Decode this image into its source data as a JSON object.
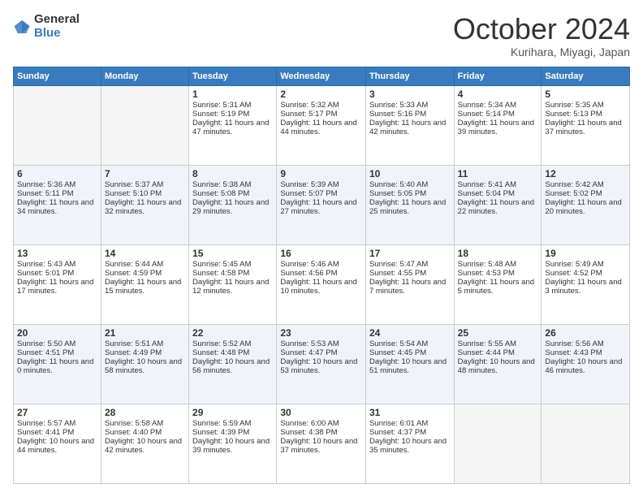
{
  "logo": {
    "general": "General",
    "blue": "Blue"
  },
  "header": {
    "month": "October 2024",
    "location": "Kurihara, Miyagi, Japan"
  },
  "days_of_week": [
    "Sunday",
    "Monday",
    "Tuesday",
    "Wednesday",
    "Thursday",
    "Friday",
    "Saturday"
  ],
  "weeks": [
    [
      {
        "day": "",
        "sunrise": "",
        "sunset": "",
        "daylight": ""
      },
      {
        "day": "",
        "sunrise": "",
        "sunset": "",
        "daylight": ""
      },
      {
        "day": "1",
        "sunrise": "Sunrise: 5:31 AM",
        "sunset": "Sunset: 5:19 PM",
        "daylight": "Daylight: 11 hours and 47 minutes."
      },
      {
        "day": "2",
        "sunrise": "Sunrise: 5:32 AM",
        "sunset": "Sunset: 5:17 PM",
        "daylight": "Daylight: 11 hours and 44 minutes."
      },
      {
        "day": "3",
        "sunrise": "Sunrise: 5:33 AM",
        "sunset": "Sunset: 5:16 PM",
        "daylight": "Daylight: 11 hours and 42 minutes."
      },
      {
        "day": "4",
        "sunrise": "Sunrise: 5:34 AM",
        "sunset": "Sunset: 5:14 PM",
        "daylight": "Daylight: 11 hours and 39 minutes."
      },
      {
        "day": "5",
        "sunrise": "Sunrise: 5:35 AM",
        "sunset": "Sunset: 5:13 PM",
        "daylight": "Daylight: 11 hours and 37 minutes."
      }
    ],
    [
      {
        "day": "6",
        "sunrise": "Sunrise: 5:36 AM",
        "sunset": "Sunset: 5:11 PM",
        "daylight": "Daylight: 11 hours and 34 minutes."
      },
      {
        "day": "7",
        "sunrise": "Sunrise: 5:37 AM",
        "sunset": "Sunset: 5:10 PM",
        "daylight": "Daylight: 11 hours and 32 minutes."
      },
      {
        "day": "8",
        "sunrise": "Sunrise: 5:38 AM",
        "sunset": "Sunset: 5:08 PM",
        "daylight": "Daylight: 11 hours and 29 minutes."
      },
      {
        "day": "9",
        "sunrise": "Sunrise: 5:39 AM",
        "sunset": "Sunset: 5:07 PM",
        "daylight": "Daylight: 11 hours and 27 minutes."
      },
      {
        "day": "10",
        "sunrise": "Sunrise: 5:40 AM",
        "sunset": "Sunset: 5:05 PM",
        "daylight": "Daylight: 11 hours and 25 minutes."
      },
      {
        "day": "11",
        "sunrise": "Sunrise: 5:41 AM",
        "sunset": "Sunset: 5:04 PM",
        "daylight": "Daylight: 11 hours and 22 minutes."
      },
      {
        "day": "12",
        "sunrise": "Sunrise: 5:42 AM",
        "sunset": "Sunset: 5:02 PM",
        "daylight": "Daylight: 11 hours and 20 minutes."
      }
    ],
    [
      {
        "day": "13",
        "sunrise": "Sunrise: 5:43 AM",
        "sunset": "Sunset: 5:01 PM",
        "daylight": "Daylight: 11 hours and 17 minutes."
      },
      {
        "day": "14",
        "sunrise": "Sunrise: 5:44 AM",
        "sunset": "Sunset: 4:59 PM",
        "daylight": "Daylight: 11 hours and 15 minutes."
      },
      {
        "day": "15",
        "sunrise": "Sunrise: 5:45 AM",
        "sunset": "Sunset: 4:58 PM",
        "daylight": "Daylight: 11 hours and 12 minutes."
      },
      {
        "day": "16",
        "sunrise": "Sunrise: 5:46 AM",
        "sunset": "Sunset: 4:56 PM",
        "daylight": "Daylight: 11 hours and 10 minutes."
      },
      {
        "day": "17",
        "sunrise": "Sunrise: 5:47 AM",
        "sunset": "Sunset: 4:55 PM",
        "daylight": "Daylight: 11 hours and 7 minutes."
      },
      {
        "day": "18",
        "sunrise": "Sunrise: 5:48 AM",
        "sunset": "Sunset: 4:53 PM",
        "daylight": "Daylight: 11 hours and 5 minutes."
      },
      {
        "day": "19",
        "sunrise": "Sunrise: 5:49 AM",
        "sunset": "Sunset: 4:52 PM",
        "daylight": "Daylight: 11 hours and 3 minutes."
      }
    ],
    [
      {
        "day": "20",
        "sunrise": "Sunrise: 5:50 AM",
        "sunset": "Sunset: 4:51 PM",
        "daylight": "Daylight: 11 hours and 0 minutes."
      },
      {
        "day": "21",
        "sunrise": "Sunrise: 5:51 AM",
        "sunset": "Sunset: 4:49 PM",
        "daylight": "Daylight: 10 hours and 58 minutes."
      },
      {
        "day": "22",
        "sunrise": "Sunrise: 5:52 AM",
        "sunset": "Sunset: 4:48 PM",
        "daylight": "Daylight: 10 hours and 56 minutes."
      },
      {
        "day": "23",
        "sunrise": "Sunrise: 5:53 AM",
        "sunset": "Sunset: 4:47 PM",
        "daylight": "Daylight: 10 hours and 53 minutes."
      },
      {
        "day": "24",
        "sunrise": "Sunrise: 5:54 AM",
        "sunset": "Sunset: 4:45 PM",
        "daylight": "Daylight: 10 hours and 51 minutes."
      },
      {
        "day": "25",
        "sunrise": "Sunrise: 5:55 AM",
        "sunset": "Sunset: 4:44 PM",
        "daylight": "Daylight: 10 hours and 48 minutes."
      },
      {
        "day": "26",
        "sunrise": "Sunrise: 5:56 AM",
        "sunset": "Sunset: 4:43 PM",
        "daylight": "Daylight: 10 hours and 46 minutes."
      }
    ],
    [
      {
        "day": "27",
        "sunrise": "Sunrise: 5:57 AM",
        "sunset": "Sunset: 4:41 PM",
        "daylight": "Daylight: 10 hours and 44 minutes."
      },
      {
        "day": "28",
        "sunrise": "Sunrise: 5:58 AM",
        "sunset": "Sunset: 4:40 PM",
        "daylight": "Daylight: 10 hours and 42 minutes."
      },
      {
        "day": "29",
        "sunrise": "Sunrise: 5:59 AM",
        "sunset": "Sunset: 4:39 PM",
        "daylight": "Daylight: 10 hours and 39 minutes."
      },
      {
        "day": "30",
        "sunrise": "Sunrise: 6:00 AM",
        "sunset": "Sunset: 4:38 PM",
        "daylight": "Daylight: 10 hours and 37 minutes."
      },
      {
        "day": "31",
        "sunrise": "Sunrise: 6:01 AM",
        "sunset": "Sunset: 4:37 PM",
        "daylight": "Daylight: 10 hours and 35 minutes."
      },
      {
        "day": "",
        "sunrise": "",
        "sunset": "",
        "daylight": ""
      },
      {
        "day": "",
        "sunrise": "",
        "sunset": "",
        "daylight": ""
      }
    ]
  ]
}
